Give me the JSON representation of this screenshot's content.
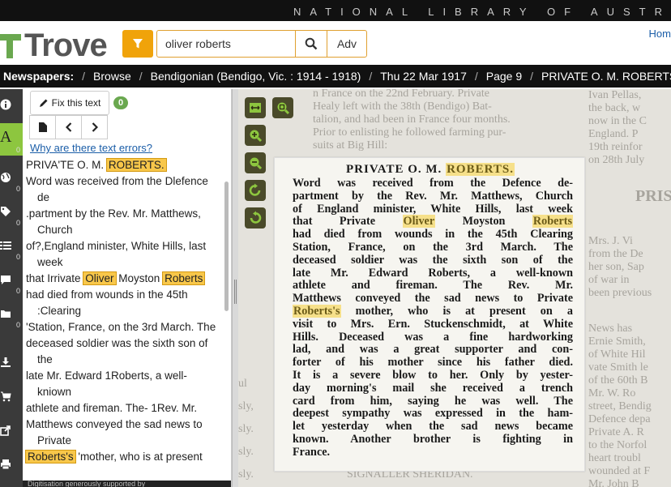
{
  "top_strip": {
    "library": "NATIONAL LIBRARY OF AUSTR"
  },
  "header": {
    "logo": "Trove",
    "search": {
      "value": "oliver roberts",
      "placeholder": ""
    },
    "adv_label": "Adv",
    "home_label": "Hom"
  },
  "breadcrumb": {
    "items": [
      "Newspapers:",
      "Browse",
      "Bendigonian (Bendigo, Vic. : 1914 - 1918)",
      "Thu 22 Mar 1917",
      "Page 9",
      "PRIVATE O. M. ROBERTS"
    ]
  },
  "tools": {
    "text_label": "A",
    "counts": [
      "0",
      "0",
      "0",
      "0",
      "0",
      "0",
      "0"
    ]
  },
  "text_panel": {
    "fix_label": "Fix this text",
    "fix_count": "0",
    "why_link": "Why are there text errors?",
    "footer": "Digitisation generously supported by",
    "ocr_lines": [
      [
        "PRIVA'TE O. M. ",
        "ROBERTS.",
        ""
      ],
      [
        "Word was received from the Dlefence de",
        "",
        ""
      ],
      [
        ".partment by the Rev. Mr. Matthews, Church",
        "",
        ""
      ],
      [
        "of?,England minister, White Hills, last week",
        "",
        ""
      ],
      [
        "that Irrivate ",
        "Oliver",
        " Moyston ",
        "Roberts"
      ],
      [
        "had died from wounds in the 45th :Clearing",
        "",
        ""
      ],
      [
        "'Station, France, on the 3rd March. The",
        "",
        ""
      ],
      [
        "deceased soldier was the sixth son of the",
        "",
        ""
      ],
      [
        "late Mr. Edward 1Roberts, a well- kniown",
        "",
        ""
      ],
      [
        "athlete and fireman. The- 1Rev. Mr.",
        "",
        ""
      ],
      [
        "Matthews conveyed the sad news to Private",
        "",
        ""
      ],
      [
        "",
        "Roberts's",
        " 'mother, who is at present",
        ""
      ]
    ]
  },
  "article": {
    "title_prefix": "PRIVATE O. M. ",
    "title_hl": "ROBERTS.",
    "lines": [
      "Word was received from the Defence de-",
      "partment by the Rev. Mr. Matthews, Church",
      "of England minister, White Hills, last week",
      "that Private |Oliver| Moyston |Roberts|",
      "had died from wounds in the 45th Clearing",
      "Station, France, on the 3rd March. The",
      "deceased soldier was the sixth son of the",
      "late Mr. Edward Roberts, a well-known",
      "athlete and fireman. The Rev. Mr.",
      "Matthews conveyed the sad news to Private",
      "|Roberts's| mother, who is at present on a",
      "visit to Mrs. Ern. Stuckenschmidt, at White",
      "Hills. Deceased was a fine hardworking",
      "lad, and was a great supporter and con-",
      "forter of his mother since his father died.",
      "It is a severe blow to her. Only by yester-",
      "day morning's mail she received a trench",
      "card from him, saying he was well. The",
      "deepest sympathy was expressed in the ham-",
      "let yesterday when the sad news became",
      "known. Another brother is fighting in",
      "France."
    ]
  },
  "background_text": {
    "top": "n France on the 22nd February. Private\nHealy left with the 38th (Bendigo) Bat-\ntalion, and had been in France four months.\nPrior to enlisting he followed farming pur-\nsuits at Big Hill:",
    "right": "Ivan Pellas,\nthe back, w\nnow in the C\nEngland. P\n19th reinfor\non 28th July",
    "right_head": "PRIS",
    "right_mid": "Mrs. J. Vi\nfrom the De\nher son, Sap\nof war in\nbeen previous",
    "right_low": "News has\nErnie Smith,\nof White Hil\nvate Smith le\nof the 60th B\nMr. W. Ro\nstreet, Bendig\nDefence depa\nPrivate A. R\nto the Norfol\nheart troubl\nwounded at F\nMr. John B",
    "bottom": "SIGNALLER SHERIDAN.",
    "left": "ul\nsly,\nsly.\nsly.\nsly."
  }
}
